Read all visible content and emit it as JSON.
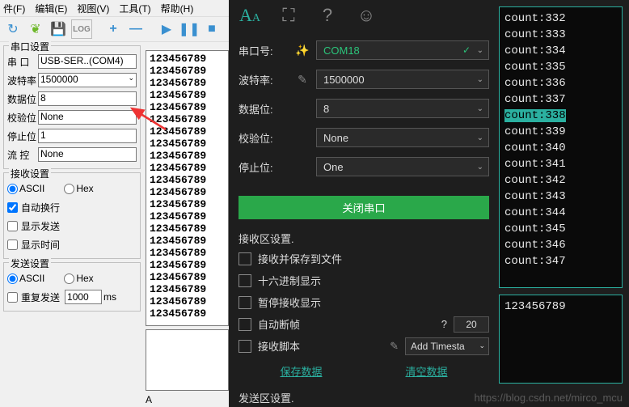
{
  "left": {
    "menu": {
      "file": "件(F)",
      "edit": "编辑(E)",
      "view": "视图(V)",
      "tools": "工具(T)",
      "help": "帮助(H)"
    },
    "group_port": {
      "title": "串口设置",
      "port_lbl": "串  口",
      "port_val": "USB-SER..(COM4)",
      "baud_lbl": "波特率",
      "baud_val": "1500000",
      "databits_lbl": "数据位",
      "databits_val": "8",
      "parity_lbl": "校验位",
      "parity_val": "None",
      "stopbits_lbl": "停止位",
      "stopbits_val": "1",
      "flow_lbl": "流  控",
      "flow_val": "None"
    },
    "group_recv": {
      "title": "接收设置",
      "ascii": "ASCII",
      "hex": "Hex",
      "autowrap": "自动换行",
      "showsend": "显示发送",
      "showtime": "显示时间"
    },
    "group_send": {
      "title": "发送设置",
      "ascii": "ASCII",
      "hex": "Hex",
      "repeat": "重复发送",
      "interval": "1000",
      "ms": "ms"
    },
    "output_line": "123456789",
    "status": "A"
  },
  "right": {
    "form": {
      "port_lbl": "串口号:",
      "port_val": "COM18",
      "baud_lbl": "波特率:",
      "baud_val": "1500000",
      "databits_lbl": "数据位:",
      "databits_val": "8",
      "parity_lbl": "校验位:",
      "parity_val": "None",
      "stopbits_lbl": "停止位:",
      "stopbits_val": "One"
    },
    "btn_close": "关闭串口",
    "recv_section": "接收区设置.",
    "chk_savefile": "接收并保存到文件",
    "chk_hex": "十六进制显示",
    "chk_pause": "暂停接收显示",
    "chk_autoframe": "自动断帧",
    "autoframe_q": "?",
    "autoframe_val": "20",
    "chk_script": "接收脚本",
    "script_val": "Add Timesta",
    "link_save": "保存数据",
    "link_clear": "清空数据",
    "send_section": "发送区设置.",
    "term_prefix": "count:",
    "term_counts": [
      "332",
      "333",
      "334",
      "335",
      "336",
      "337",
      "338",
      "339",
      "340",
      "341",
      "342",
      "343",
      "344",
      "345",
      "346",
      "347"
    ],
    "term_highlight_index": 6,
    "term_bottom": "123456789"
  },
  "watermark": "https://blog.csdn.net/mirco_mcu"
}
